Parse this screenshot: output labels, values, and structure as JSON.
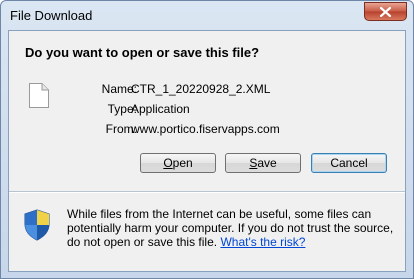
{
  "window": {
    "title": "File Download",
    "close_icon": "close-icon"
  },
  "dialog": {
    "question": "Do you want to open or save this file?",
    "file_icon": "generic-file-icon",
    "labels": {
      "name": "Name:",
      "type": "Type:",
      "from": "From:"
    },
    "values": {
      "name": "CTR_1_20220928_2.XML",
      "type": "Application",
      "from": "www.portico.fiservapps.com"
    },
    "buttons": {
      "open_prefix": "",
      "open_hotkey": "O",
      "open_rest": "pen",
      "save_prefix": "",
      "save_hotkey": "S",
      "save_rest": "ave",
      "cancel": "Cancel"
    },
    "warning": {
      "icon": "shield-icon",
      "text": "While files from the Internet can be useful, some files can potentially harm your computer. If you do not trust the source, do not open or save this file.",
      "link": "What's the risk?"
    }
  },
  "colors": {
    "link": "#0046d5",
    "close_button": "#c75a45",
    "dialog_bg": "#f0f0f0"
  }
}
